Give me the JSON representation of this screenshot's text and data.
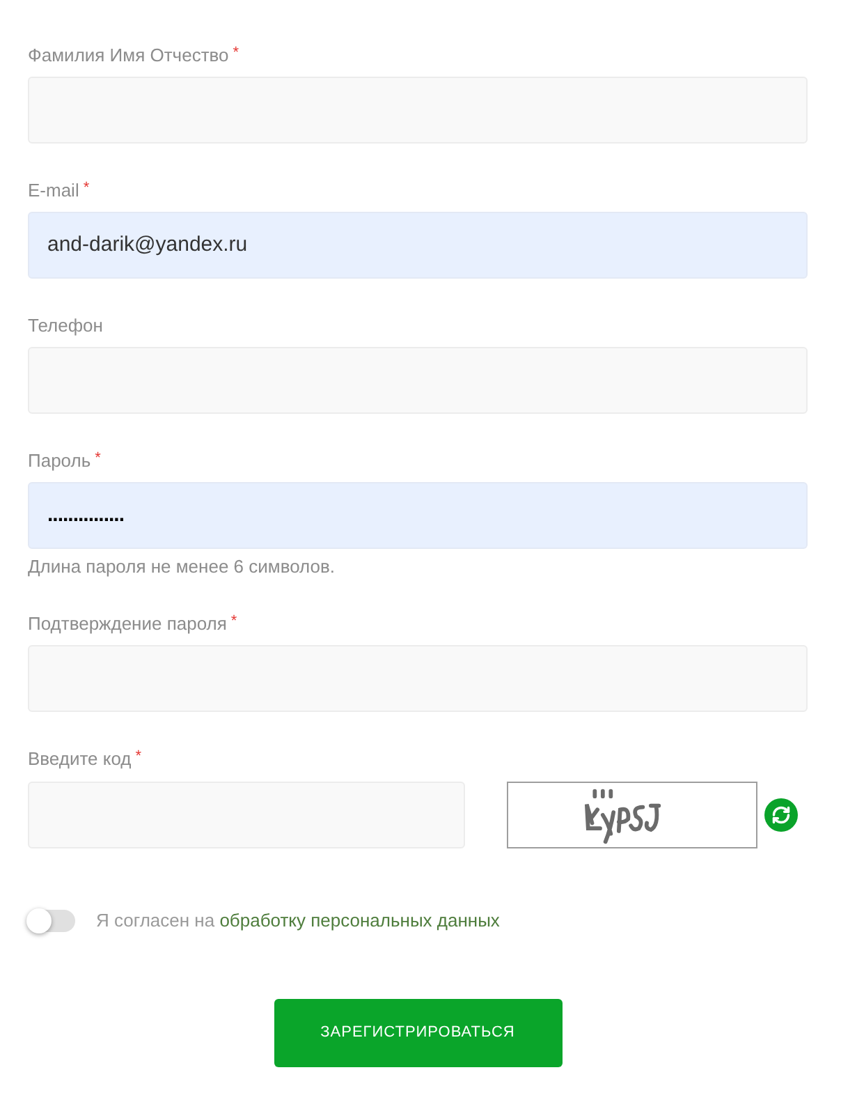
{
  "fields": [
    {
      "kind": "text",
      "label": "Фамилия Имя Отчество",
      "required_mark": "*",
      "autofilled": false
    },
    {
      "kind": "text",
      "label": "E-mail",
      "required_mark": "*",
      "autofilled": true,
      "value": "and-darik@yandex.ru"
    },
    {
      "kind": "text",
      "label": "Телефон",
      "autofilled": false
    },
    {
      "kind": "password",
      "label": "Пароль",
      "required_mark": "*",
      "autofilled": true,
      "value": "...............",
      "hint": "Длина пароля не менее 6 символов."
    },
    {
      "kind": "password",
      "label": "Подтверждение пароля",
      "required_mark": "*",
      "autofilled": false
    },
    {
      "kind": "captcha",
      "label": "Введите код",
      "required_mark": "*",
      "autofilled": false
    }
  ],
  "consent": {
    "on": false,
    "text": "Я согласен на",
    "link": "обработку персональных данных"
  },
  "submit_button": "ЗАРЕГИСТРИРОВАТЬСЯ"
}
